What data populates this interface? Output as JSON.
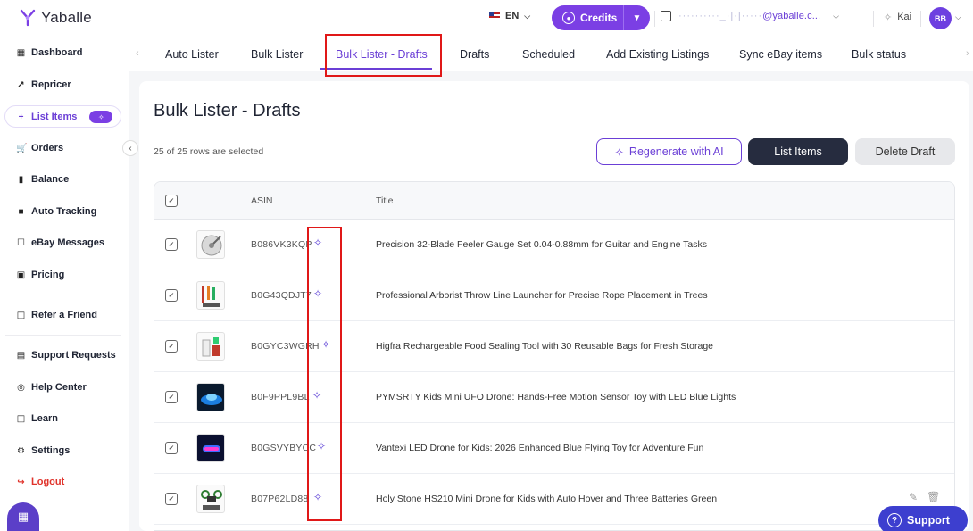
{
  "app": {
    "logo_text": "Yaballe",
    "brand_color": "#7b3fe4"
  },
  "header": {
    "language": "EN",
    "credits_label": "Credits",
    "store_blurred": "··········_·|·|·····",
    "store_email": "@yaballe.c...",
    "kai_label": "Kai",
    "avatar_initials": "BB"
  },
  "sidebar": {
    "items": [
      {
        "label": "Dashboard",
        "icon": "dashboard-icon"
      },
      {
        "label": "Repricer",
        "icon": "trend-icon"
      },
      {
        "label": "List Items",
        "icon": "plus-icon",
        "active": true
      },
      {
        "label": "Orders",
        "icon": "cart-icon"
      },
      {
        "label": "Balance",
        "icon": "balance-icon"
      },
      {
        "label": "Auto Tracking",
        "icon": "truck-icon"
      },
      {
        "label": "eBay Messages",
        "icon": "message-icon"
      },
      {
        "label": "Pricing",
        "icon": "pricing-icon"
      },
      {
        "label": "Refer a Friend",
        "icon": "gift-icon"
      },
      {
        "label": "Support Requests",
        "icon": "support-request-icon"
      },
      {
        "label": "Help Center",
        "icon": "help-icon"
      },
      {
        "label": "Learn",
        "icon": "book-icon"
      },
      {
        "label": "Settings",
        "icon": "gear-icon"
      },
      {
        "label": "Logout",
        "icon": "logout-icon"
      }
    ]
  },
  "tabs": [
    {
      "label": "Auto Lister"
    },
    {
      "label": "Bulk Lister"
    },
    {
      "label": "Bulk Lister - Drafts",
      "active": true
    },
    {
      "label": "Drafts"
    },
    {
      "label": "Scheduled"
    },
    {
      "label": "Add Existing Listings"
    },
    {
      "label": "Sync eBay items"
    },
    {
      "label": "Bulk status"
    }
  ],
  "main": {
    "title": "Bulk Lister - Drafts",
    "selected_info": "25 of 25 rows are selected",
    "regenerate_label": "Regenerate with AI",
    "list_items_label": "List Items",
    "delete_label": "Delete Draft"
  },
  "table": {
    "columns": {
      "asin": "ASIN",
      "title": "Title"
    },
    "rows": [
      {
        "asin": "B086VK3KQP",
        "title": "Precision 32-Blade Feeler Gauge Set 0.04-0.88mm for Guitar and Engine Tasks"
      },
      {
        "asin": "B0G43QDJT7",
        "title": "Professional Arborist Throw Line Launcher for Precise Rope Placement in Trees"
      },
      {
        "asin": "B0GYC3WGRH",
        "title": "Higfra Rechargeable Food Sealing Tool with 30 Reusable Bags for Fresh Storage"
      },
      {
        "asin": "B0F9PPL9BL",
        "title": "PYMSRTY Kids Mini UFO Drone: Hands-Free Motion Sensor Toy with LED Blue Lights"
      },
      {
        "asin": "B0GSVYBYCC",
        "title": "Vantexi LED Drone for Kids: 2026 Enhanced Blue Flying Toy for Adventure Fun"
      },
      {
        "asin": "B07P62LD88",
        "title": "Holy Stone HS210 Mini Drone for Kids with Auto Hover and Three Batteries Green"
      }
    ]
  },
  "support": {
    "label": "Support"
  }
}
